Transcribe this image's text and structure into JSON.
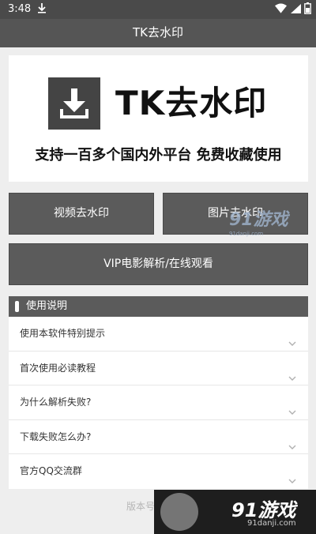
{
  "status_bar": {
    "time": "3:48"
  },
  "app_bar": {
    "title": "TK去水印"
  },
  "banner": {
    "logo_text": "TK去水印",
    "slogan": "支持一百多个国内外平台 免费收藏使用"
  },
  "buttons": {
    "video": "视频去水印",
    "image": "图片去水印",
    "vip": "VIP电影解析/在线观看"
  },
  "usage": {
    "title": "使用说明",
    "items": [
      {
        "label": "使用本软件特别提示"
      },
      {
        "label": "首次使用必读教程"
      },
      {
        "label": "为什么解析失败?"
      },
      {
        "label": "下载失败怎么办?"
      },
      {
        "label": "官方QQ交流群"
      }
    ]
  },
  "footer": {
    "version": "版本号"
  },
  "watermarks": {
    "site_name": "91游戏",
    "site_url": "91danji.com"
  },
  "colors": {
    "header": "#555555",
    "button": "#5b5b5b",
    "background": "#eeeeee"
  }
}
